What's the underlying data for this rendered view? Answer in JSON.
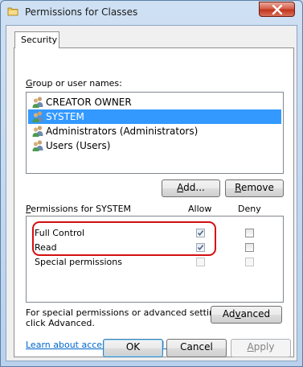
{
  "window": {
    "title": "Permissions for Classes"
  },
  "tabs": [
    {
      "label": "Security",
      "active": true
    }
  ],
  "group_section": {
    "label_accel": "G",
    "label_rest": "roup or user names:",
    "items": [
      {
        "name": "CREATOR OWNER",
        "selected": false
      },
      {
        "name": "SYSTEM",
        "selected": true
      },
      {
        "name": "Administrators (Administrators)",
        "selected": false
      },
      {
        "name": "Users (Users)",
        "selected": false
      }
    ],
    "add_button": {
      "accel": "A",
      "rest": "dd..."
    },
    "remove_button": {
      "accel": "R",
      "rest": "emove"
    }
  },
  "permissions": {
    "label_accel": "P",
    "label_rest": "ermissions for SYSTEM",
    "allow_header": "Allow",
    "deny_header": "Deny",
    "rows": [
      {
        "name": "Full Control",
        "allow": true,
        "deny": false,
        "disabled": false
      },
      {
        "name": "Read",
        "allow": true,
        "deny": false,
        "disabled": false
      },
      {
        "name": "Special permissions",
        "allow": false,
        "deny": false,
        "disabled": true
      }
    ]
  },
  "advanced": {
    "text_line1": "For special permissions or advanced settings,",
    "text_line2": "click Advanced.",
    "button_pre": "Ad",
    "button_accel": "v",
    "button_post": "anced"
  },
  "link_text": "Learn about access control and permissions",
  "footer": {
    "ok": "OK",
    "cancel": "Cancel",
    "apply_accel": "A",
    "apply_rest": "pply"
  },
  "colors": {
    "selection": "#3399ff",
    "highlight_ring": "#d40f10",
    "link": "#0066cc"
  }
}
